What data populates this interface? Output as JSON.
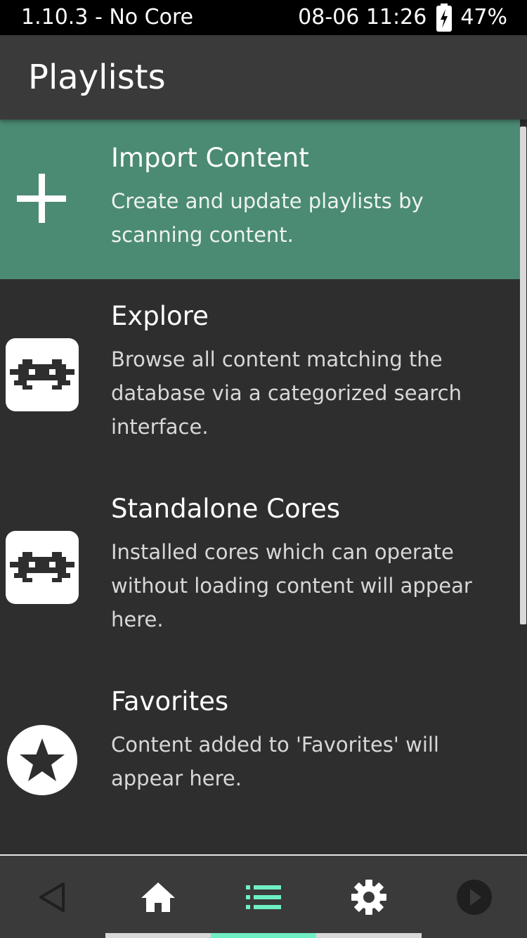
{
  "status_bar": {
    "app_info": "1.10.3 - No Core",
    "datetime": "08-06 11:26",
    "battery_percent": "47%"
  },
  "header": {
    "title": "Playlists"
  },
  "menu": {
    "items": [
      {
        "label": "Import Content",
        "sublabel": "Create and update playlists by scanning content.",
        "icon": "plus-icon",
        "selected": true
      },
      {
        "label": "Explore",
        "sublabel": "Browse all content matching the database via a categorized search interface.",
        "icon": "retroarch-invader-icon",
        "selected": false
      },
      {
        "label": "Standalone Cores",
        "sublabel": "Installed cores which can operate without loading content will appear here.",
        "icon": "retroarch-invader-icon",
        "selected": false
      },
      {
        "label": "Favorites",
        "sublabel": "Content added to 'Favorites' will appear here.",
        "icon": "star-circle-icon",
        "selected": false
      }
    ]
  },
  "bottom_nav": {
    "items": [
      {
        "name": "back",
        "icon": "back-triangle-icon",
        "active": false
      },
      {
        "name": "home",
        "icon": "home-icon",
        "active": false
      },
      {
        "name": "playlists",
        "icon": "list-icon",
        "active": true
      },
      {
        "name": "settings",
        "icon": "gear-icon",
        "active": false
      },
      {
        "name": "resume",
        "icon": "play-circle-icon",
        "active": false
      }
    ]
  },
  "colors": {
    "selected_row": "#4b8b73",
    "accent": "#6ef0c4",
    "background": "#2e2e2e",
    "header": "#3a3a3a"
  }
}
